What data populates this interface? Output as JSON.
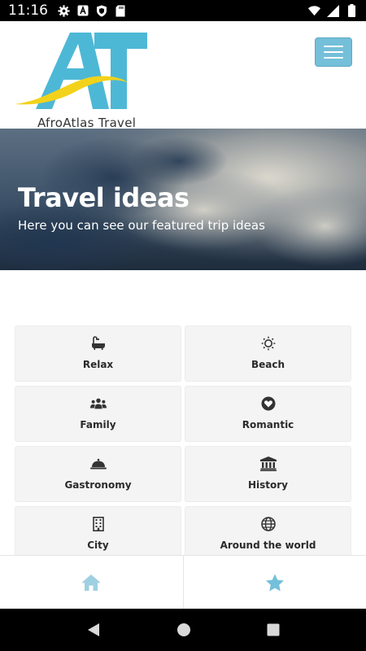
{
  "status_bar": {
    "time": "11:16",
    "left_icons": [
      "gear-icon",
      "a-notification-icon",
      "shield-icon",
      "sd-card-icon"
    ],
    "right_icons": [
      "wifi-icon",
      "signal-icon",
      "battery-icon"
    ]
  },
  "header": {
    "logo_letters": "AT",
    "brand_name": "AfroAtlas Travel",
    "menu_icon": "hamburger-icon"
  },
  "hero": {
    "title": "Travel ideas",
    "subtitle": "Here you can see our featured trip ideas"
  },
  "ideas": [
    {
      "label": "Relax",
      "icon": "bathtub-icon"
    },
    {
      "label": "Beach",
      "icon": "sun-icon"
    },
    {
      "label": "Family",
      "icon": "people-icon"
    },
    {
      "label": "Romantic",
      "icon": "heart-icon"
    },
    {
      "label": "Gastronomy",
      "icon": "cloche-icon"
    },
    {
      "label": "History",
      "icon": "landmark-icon"
    },
    {
      "label": "City",
      "icon": "building-icon"
    },
    {
      "label": "Around the world",
      "icon": "globe-icon"
    }
  ],
  "bottom_nav": {
    "tabs": [
      {
        "icon": "home-icon"
      },
      {
        "icon": "star-icon"
      }
    ]
  },
  "system_nav": [
    "back-icon",
    "home-circle-icon",
    "recents-icon"
  ],
  "colors": {
    "accent": "#74bfd9",
    "logo_blue": "#4db8d6",
    "logo_yellow": "#f2d21b",
    "card_bg": "#f4f4f4"
  }
}
